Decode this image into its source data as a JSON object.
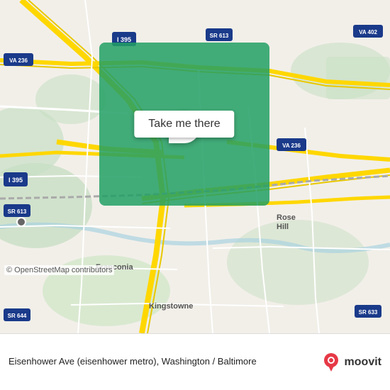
{
  "map": {
    "copyright": "© OpenStreetMap contributors",
    "overlay_color": "#22a064"
  },
  "button": {
    "label": "Take me there"
  },
  "bottom_bar": {
    "location_text": "Eisenhower Ave (eisenhower metro), Washington / Baltimore",
    "moovit_label": "moovit"
  },
  "road_labels": [
    "I 395",
    "VA 236",
    "SR 613",
    "VA 402",
    "I-395",
    "SR 644",
    "SR 633",
    "SR 613"
  ],
  "place_labels": [
    "Rose Hill",
    "Franconia",
    "Kingstowne"
  ]
}
